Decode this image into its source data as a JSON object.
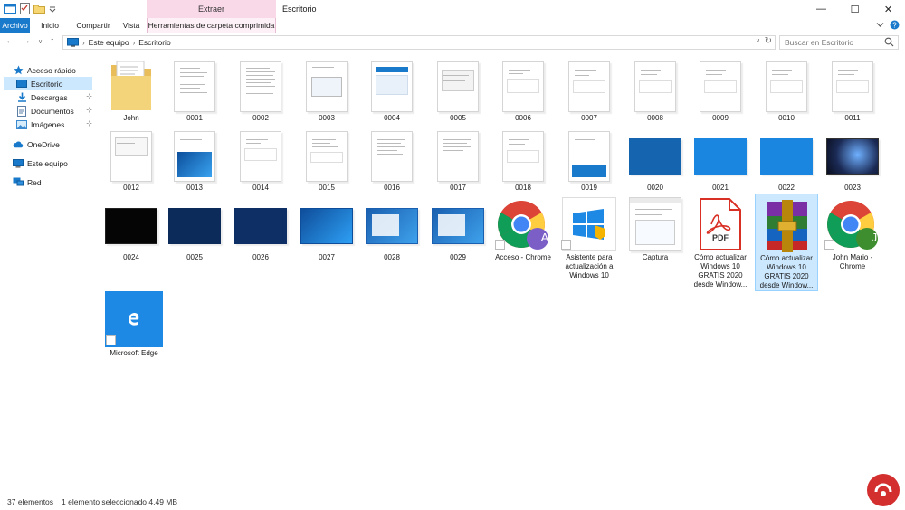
{
  "window": {
    "title": "Escritorio",
    "context_tab_header": "Extraer",
    "controls": [
      "—",
      "☐",
      "✕"
    ]
  },
  "ribbon": {
    "tabs": [
      "Archivo",
      "Inicio",
      "Compartir",
      "Vista",
      "Herramientas de carpeta comprimida"
    ]
  },
  "address": {
    "crumbs": [
      "Este equipo",
      "Escritorio"
    ],
    "search_placeholder": "Buscar en Escritorio"
  },
  "nav": {
    "items": [
      {
        "label": "Acceso rápido"
      },
      {
        "label": "Escritorio"
      },
      {
        "label": "Descargas"
      },
      {
        "label": "Documentos"
      },
      {
        "label": "Imágenes"
      },
      {
        "label": "OneDrive"
      },
      {
        "label": "Este equipo"
      },
      {
        "label": "Red"
      }
    ]
  },
  "files": [
    {
      "label": "John"
    },
    {
      "label": "0001"
    },
    {
      "label": "0002"
    },
    {
      "label": "0003"
    },
    {
      "label": "0004"
    },
    {
      "label": "0005"
    },
    {
      "label": "0006"
    },
    {
      "label": "0007"
    },
    {
      "label": "0008"
    },
    {
      "label": "0009"
    },
    {
      "label": "0010"
    },
    {
      "label": "0011"
    },
    {
      "label": "0012"
    },
    {
      "label": "0013"
    },
    {
      "label": "0014"
    },
    {
      "label": "0015"
    },
    {
      "label": "0016"
    },
    {
      "label": "0017"
    },
    {
      "label": "0018"
    },
    {
      "label": "0019"
    },
    {
      "label": "0020"
    },
    {
      "label": "0021"
    },
    {
      "label": "0022"
    },
    {
      "label": "0023"
    },
    {
      "label": "0024"
    },
    {
      "label": "0025"
    },
    {
      "label": "0026"
    },
    {
      "label": "0027"
    },
    {
      "label": "0028"
    },
    {
      "label": "0029"
    },
    {
      "label": "Acceso - Chrome",
      "avatar": "A"
    },
    {
      "label": "Asistente para actualización a Windows 10"
    },
    {
      "label": "Captura"
    },
    {
      "label": "Cómo actualizar Windows 10 GRATIS 2020 desde Window...",
      "pdf": "PDF"
    },
    {
      "label": "Cómo actualizar Windows 10 GRATIS 2020 desde Window..."
    },
    {
      "label": "John Mario - Chrome",
      "avatar": "J"
    },
    {
      "label": "Microsoft Edge"
    }
  ],
  "status": {
    "count": "37 elementos",
    "selection": "1 elemento seleccionado  4,49 MB"
  },
  "colors": {
    "accent": "#1979ca",
    "selection": "#cce8ff",
    "context_tab": "#f9d8e8"
  }
}
